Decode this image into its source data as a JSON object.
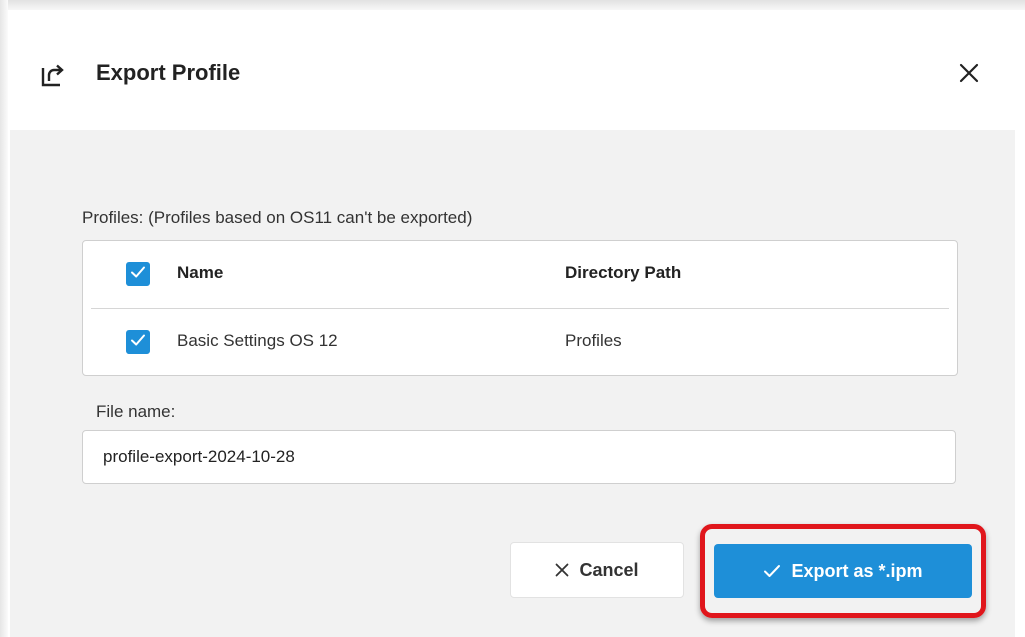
{
  "dialog": {
    "title": "Export Profile",
    "header_icon": "export-icon",
    "close_icon": "close-icon"
  },
  "profiles": {
    "label": "Profiles: (Profiles based on OS11 can't be exported)",
    "columns": [
      "Name",
      "Directory Path"
    ],
    "select_all_checked": true,
    "rows": [
      {
        "checked": true,
        "name": "Basic Settings OS 12",
        "path": "Profiles"
      }
    ]
  },
  "file": {
    "label": "File name:",
    "value": "profile-export-2024-10-28"
  },
  "buttons": {
    "cancel_label": "Cancel",
    "cancel_icon": "close-icon",
    "export_label": "Export as *.ipm",
    "export_icon": "check-icon"
  },
  "colors": {
    "accent": "#1e8fd8",
    "highlight": "#e0161c",
    "body_bg": "#f2f2f2"
  }
}
